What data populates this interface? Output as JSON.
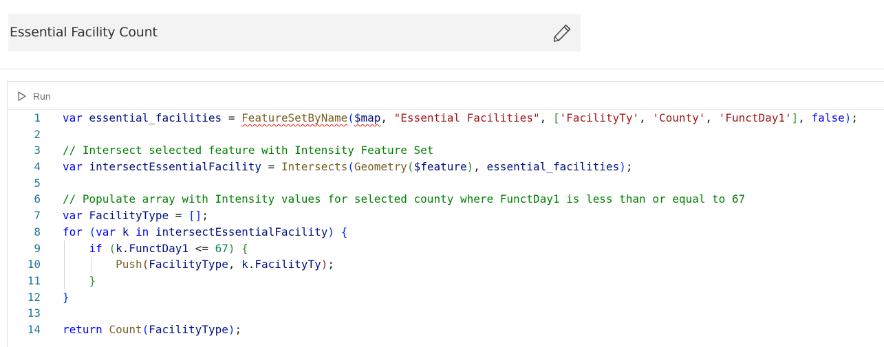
{
  "header": {
    "title": "Essential Facility Count"
  },
  "toolbar": {
    "run_label": "Run"
  },
  "editor": {
    "lines": [
      {
        "number": "1",
        "tokens": [
          {
            "t": "var ",
            "c": "kw"
          },
          {
            "t": "essential_facilities",
            "c": "ident"
          },
          {
            "t": " = ",
            "c": "pn"
          },
          {
            "t": "FeatureSetByName",
            "c": "fn",
            "sq": true
          },
          {
            "t": "(",
            "c": "br1"
          },
          {
            "t": "$map",
            "c": "ident",
            "sq": true
          },
          {
            "t": ", ",
            "c": "pn"
          },
          {
            "t": "\"Essential Facilities\"",
            "c": "str"
          },
          {
            "t": ", ",
            "c": "pn"
          },
          {
            "t": "[",
            "c": "br2"
          },
          {
            "t": "'FacilityTy'",
            "c": "str"
          },
          {
            "t": ", ",
            "c": "pn"
          },
          {
            "t": "'County'",
            "c": "str"
          },
          {
            "t": ", ",
            "c": "pn"
          },
          {
            "t": "'FunctDay1'",
            "c": "str"
          },
          {
            "t": "]",
            "c": "br2"
          },
          {
            "t": ", ",
            "c": "pn"
          },
          {
            "t": "false",
            "c": "kw"
          },
          {
            "t": ")",
            "c": "br1"
          },
          {
            "t": ";",
            "c": "pn"
          }
        ]
      },
      {
        "number": "2",
        "tokens": []
      },
      {
        "number": "3",
        "tokens": [
          {
            "t": "// Intersect selected feature with Intensity Feature Set",
            "c": "cmt"
          }
        ]
      },
      {
        "number": "4",
        "tokens": [
          {
            "t": "var ",
            "c": "kw"
          },
          {
            "t": "intersectEssentialFacility",
            "c": "ident"
          },
          {
            "t": " = ",
            "c": "pn"
          },
          {
            "t": "Intersects",
            "c": "fn"
          },
          {
            "t": "(",
            "c": "br1"
          },
          {
            "t": "Geometry",
            "c": "fn"
          },
          {
            "t": "(",
            "c": "br2"
          },
          {
            "t": "$feature",
            "c": "ident"
          },
          {
            "t": ")",
            "c": "br2"
          },
          {
            "t": ", ",
            "c": "pn"
          },
          {
            "t": "essential_facilities",
            "c": "ident"
          },
          {
            "t": ")",
            "c": "br1"
          },
          {
            "t": ";",
            "c": "pn"
          }
        ]
      },
      {
        "number": "5",
        "tokens": []
      },
      {
        "number": "6",
        "tokens": [
          {
            "t": "// Populate array with Intensity values for selected county where FunctDay1 is less than or equal to 67",
            "c": "cmt"
          }
        ]
      },
      {
        "number": "7",
        "tokens": [
          {
            "t": "var ",
            "c": "kw"
          },
          {
            "t": "FacilityType",
            "c": "ident"
          },
          {
            "t": " = ",
            "c": "pn"
          },
          {
            "t": "[]",
            "c": "br1"
          },
          {
            "t": ";",
            "c": "pn"
          }
        ]
      },
      {
        "number": "8",
        "tokens": [
          {
            "t": "for ",
            "c": "kw"
          },
          {
            "t": "(",
            "c": "br1"
          },
          {
            "t": "var ",
            "c": "kw"
          },
          {
            "t": "k",
            "c": "ident"
          },
          {
            "t": " in ",
            "c": "kw"
          },
          {
            "t": "intersectEssentialFacility",
            "c": "ident"
          },
          {
            "t": ") ",
            "c": "br1"
          },
          {
            "t": "{",
            "c": "br1"
          }
        ]
      },
      {
        "number": "9",
        "indent": 1,
        "tokens": [
          {
            "t": "    ",
            "c": "pn"
          },
          {
            "t": "if ",
            "c": "kw"
          },
          {
            "t": "(",
            "c": "br2"
          },
          {
            "t": "k",
            "c": "ident"
          },
          {
            "t": ".",
            "c": "pn"
          },
          {
            "t": "FunctDay1",
            "c": "ident"
          },
          {
            "t": " <= ",
            "c": "pn"
          },
          {
            "t": "67",
            "c": "num"
          },
          {
            "t": ") ",
            "c": "br2"
          },
          {
            "t": "{",
            "c": "br2"
          }
        ]
      },
      {
        "number": "10",
        "indent": 2,
        "tokens": [
          {
            "t": "        ",
            "c": "pn"
          },
          {
            "t": "Push",
            "c": "fn"
          },
          {
            "t": "(",
            "c": "br3"
          },
          {
            "t": "FacilityType",
            "c": "ident"
          },
          {
            "t": ", ",
            "c": "pn"
          },
          {
            "t": "k",
            "c": "ident"
          },
          {
            "t": ".",
            "c": "pn"
          },
          {
            "t": "FacilityTy",
            "c": "ident"
          },
          {
            "t": ")",
            "c": "br3"
          },
          {
            "t": ";",
            "c": "pn"
          }
        ]
      },
      {
        "number": "11",
        "indent": 1,
        "tokens": [
          {
            "t": "    ",
            "c": "pn"
          },
          {
            "t": "}",
            "c": "br2"
          }
        ]
      },
      {
        "number": "12",
        "tokens": [
          {
            "t": "}",
            "c": "br1"
          }
        ]
      },
      {
        "number": "13",
        "tokens": []
      },
      {
        "number": "14",
        "tokens": [
          {
            "t": "return ",
            "c": "kw"
          },
          {
            "t": "Count",
            "c": "fn"
          },
          {
            "t": "(",
            "c": "br1"
          },
          {
            "t": "FacilityType",
            "c": "ident"
          },
          {
            "t": ")",
            "c": "br1"
          },
          {
            "t": ";",
            "c": "pn"
          }
        ]
      }
    ]
  }
}
